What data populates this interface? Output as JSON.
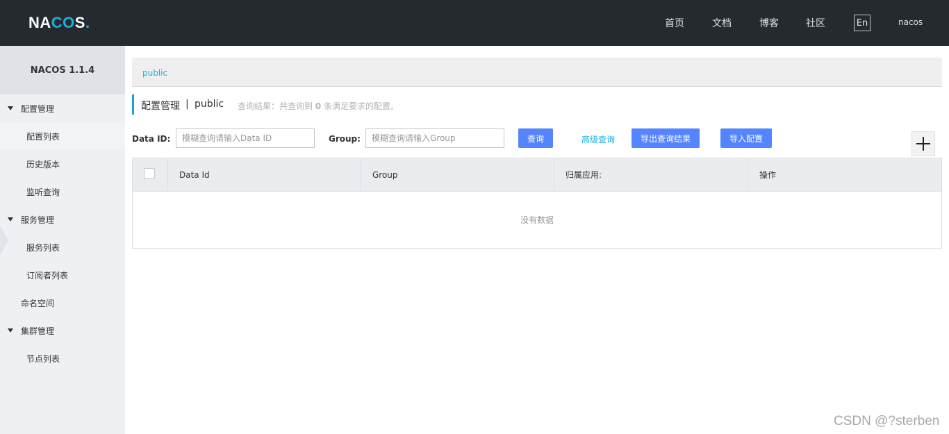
{
  "header": {
    "logo": {
      "pre": "NA",
      "o": "CO",
      "post": "S",
      "dot": "."
    },
    "nav": [
      "首页",
      "文档",
      "博客",
      "社区"
    ],
    "lang": "En",
    "user": "nacos"
  },
  "sidebar": {
    "title": "NACOS 1.1.4",
    "items": [
      {
        "label": "配置管理"
      },
      {
        "label": "配置列表"
      },
      {
        "label": "历史版本"
      },
      {
        "label": "监听查询"
      },
      {
        "label": "服务管理"
      },
      {
        "label": "服务列表"
      },
      {
        "label": "订阅者列表"
      },
      {
        "label": "命名空间"
      },
      {
        "label": "集群管理"
      },
      {
        "label": "节点列表"
      }
    ]
  },
  "namespace": {
    "current": "public"
  },
  "page": {
    "title": "配置管理",
    "separator": "|",
    "namespace": "public",
    "result_prefix": "查询结果：共查询到",
    "result_count": "0",
    "result_suffix": "条满足要求的配置。"
  },
  "search": {
    "data_id_label": "Data ID:",
    "data_id_placeholder": "模糊查询请输入Data ID",
    "group_label": "Group:",
    "group_placeholder": "模糊查询请输入Group",
    "query_button": "查询",
    "advanced_link": "高级查询",
    "export_button": "导出查询结果",
    "import_button": "导入配置"
  },
  "table": {
    "columns": [
      "Data Id",
      "Group",
      "归属应用:",
      "操作"
    ],
    "empty_text": "没有数据"
  },
  "watermark": "CSDN @?sterben",
  "colors": {
    "header_bg": "#252a2f",
    "accent": "#1bb0dc",
    "primary_button": "#5584ff"
  }
}
